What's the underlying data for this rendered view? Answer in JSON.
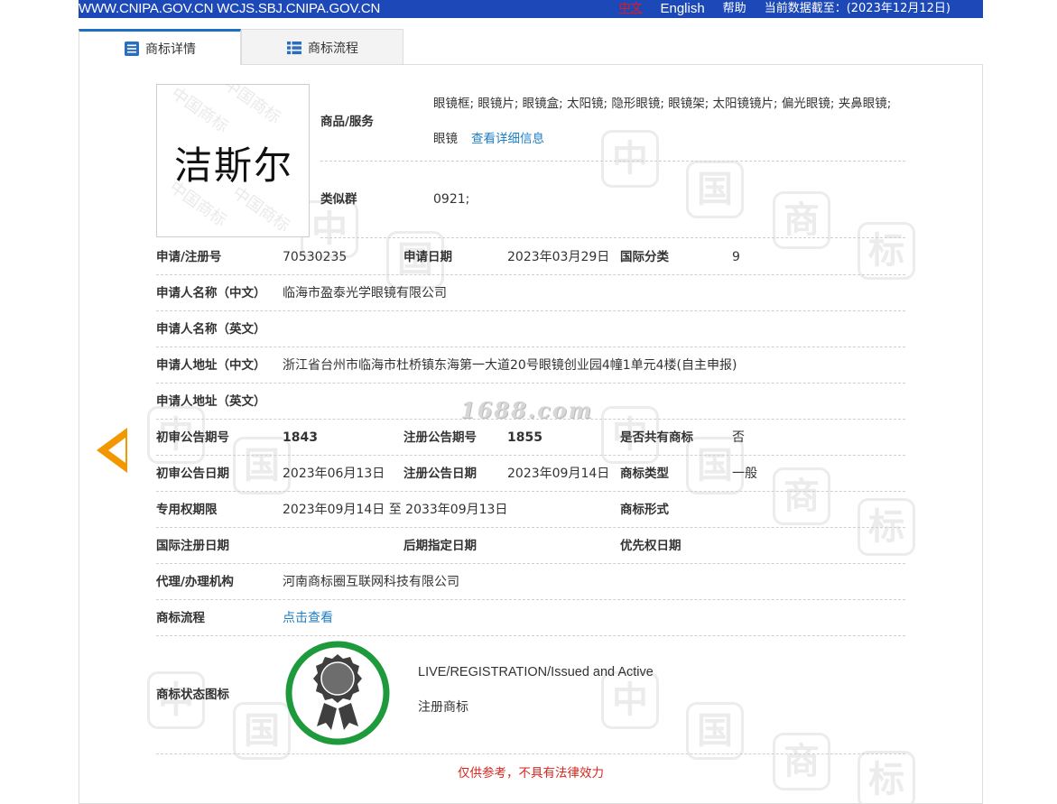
{
  "topbar": {
    "sites": "WWW.CNIPA.GOV.CN WCJS.SBJ.CNIPA.GOV.CN",
    "lang_zh": "中文",
    "lang_en": "English",
    "help": "帮助",
    "data_as_of": "当前数据截至：(2023年12月12日)"
  },
  "tabs": [
    {
      "label": "商标详情",
      "icon": "document-list-icon",
      "active": true
    },
    {
      "label": "商标流程",
      "icon": "list-icon",
      "active": false
    }
  ],
  "mark": {
    "name": "洁斯尔",
    "watermark": "中国商标"
  },
  "goods": {
    "label": "商品/服务",
    "value_line1": "眼镜框; 眼镜片; 眼镜盒; 太阳镜; 隐形眼镜; 眼镜架; 太阳镜镜片; 偏光眼镜; 夹鼻眼镜;",
    "value_line2": "眼镜",
    "detail_link": "查看详细信息"
  },
  "similar_group": {
    "label": "类似群",
    "value": "0921;"
  },
  "rows": {
    "reg_no": {
      "label": "申请/注册号",
      "value": "70530235"
    },
    "app_date": {
      "label": "申请日期",
      "value": "2023年03月29日"
    },
    "intl_class": {
      "label": "国际分类",
      "value": "9"
    },
    "applicant_cn": {
      "label": "申请人名称（中文）",
      "value": "临海市盈泰光学眼镜有限公司"
    },
    "applicant_en": {
      "label": "申请人名称（英文）",
      "value": ""
    },
    "address_cn": {
      "label": "申请人地址（中文）",
      "value": "浙江省台州市临海市杜桥镇东海第一大道20号眼镜创业园4幢1单元4楼(自主申报)"
    },
    "address_en": {
      "label": "申请人地址（英文）",
      "value": ""
    },
    "prelim_issue": {
      "label": "初审公告期号",
      "value": "1843"
    },
    "reg_issue": {
      "label": "注册公告期号",
      "value": "1855"
    },
    "shared": {
      "label": "是否共有商标",
      "value": "否"
    },
    "prelim_date": {
      "label": "初审公告日期",
      "value": "2023年06月13日"
    },
    "reg_date": {
      "label": "注册公告日期",
      "value": "2023年09月14日"
    },
    "mark_type": {
      "label": "商标类型",
      "value": "一般"
    },
    "term": {
      "label": "专用权期限",
      "value": "2023年09月14日 至 2033年09月13日"
    },
    "mark_form": {
      "label": "商标形式",
      "value": ""
    },
    "intl_reg_date": {
      "label": "国际注册日期",
      "value": ""
    },
    "later_date": {
      "label": "后期指定日期",
      "value": ""
    },
    "priority_date": {
      "label": "优先权日期",
      "value": ""
    },
    "agent": {
      "label": "代理/办理机构",
      "value": "河南商标圈互联网科技有限公司"
    },
    "flow": {
      "label": "商标流程",
      "value": "点击查看"
    }
  },
  "status": {
    "label": "商标状态图标",
    "en": "LIVE/REGISTRATION/Issued and Active",
    "cn": "注册商标",
    "seal_color": "#1e9a3c"
  },
  "watermark_text": "1688.com",
  "disclaimer": "仅供参考，不具有法律效力",
  "colors": {
    "topbar": "#1d48b8",
    "link": "#1d7fc4",
    "accent": "#f39700",
    "warning": "#d9251c"
  }
}
